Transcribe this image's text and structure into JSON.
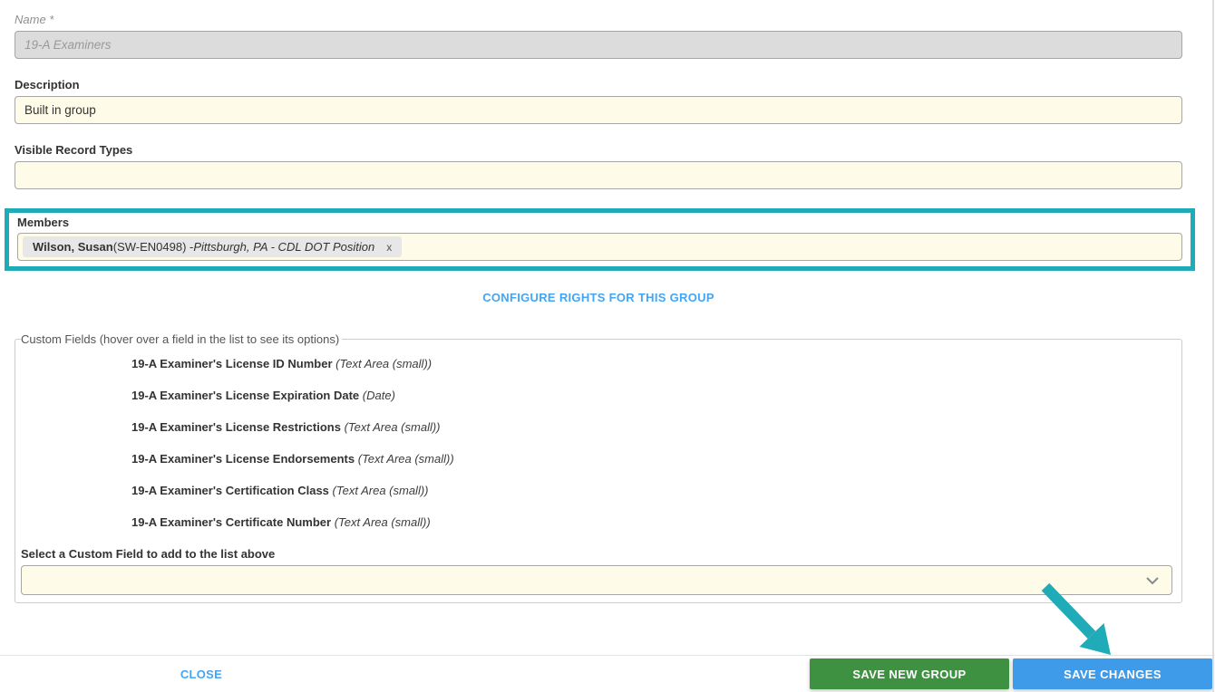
{
  "colors": {
    "teal": "#1fabb8",
    "link-blue": "#42a5f5",
    "button-green": "#3f9142",
    "button-blue": "#3e9be9",
    "input-yellow": "#fefce8"
  },
  "form": {
    "name": {
      "label": "Name *",
      "value": "19-A Examiners"
    },
    "description": {
      "label": "Description",
      "value": "Built in group"
    },
    "visible_record_types": {
      "label": "Visible Record Types",
      "value": ""
    },
    "members": {
      "label": "Members",
      "chips": [
        {
          "name": "Wilson, Susan",
          "id": " (SW-EN0498) - ",
          "detail": "Pittsburgh, PA - CDL DOT Position",
          "remove": "x"
        }
      ]
    },
    "configure_rights_link": "CONFIGURE RIGHTS FOR THIS GROUP",
    "custom_fields": {
      "legend": "Custom Fields (hover over a field in the list to see its options)",
      "items": [
        {
          "name": "19-A Examiner's License ID Number",
          "type": "(Text Area (small))"
        },
        {
          "name": "19-A Examiner's License Expiration Date",
          "type": "(Date)"
        },
        {
          "name": "19-A Examiner's License Restrictions",
          "type": "(Text Area (small))"
        },
        {
          "name": "19-A Examiner's License Endorsements",
          "type": "(Text Area (small))"
        },
        {
          "name": "19-A Examiner's Certification Class",
          "type": "(Text Area (small))"
        },
        {
          "name": "19-A Examiner's Certificate Number",
          "type": "(Text Area (small))"
        }
      ],
      "add_label": "Select a Custom Field to add to the list above",
      "select_value": ""
    }
  },
  "footer": {
    "close_label": "CLOSE",
    "save_new_group_label": "SAVE NEW GROUP",
    "save_changes_label": "SAVE CHANGES"
  }
}
